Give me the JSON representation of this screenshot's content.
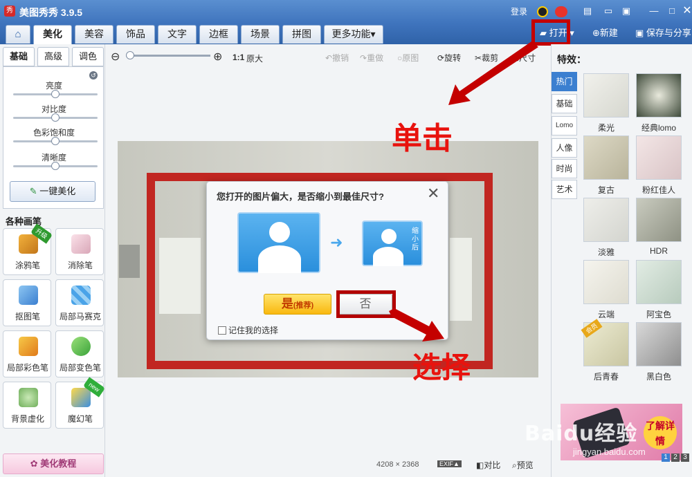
{
  "app": {
    "title": "美图秀秀 3.9.5",
    "logo_text": "秀"
  },
  "titlebar": {
    "login": "登录"
  },
  "tabs": [
    "美化",
    "美容",
    "饰品",
    "文字",
    "边框",
    "场景",
    "拼图",
    "更多功能▾"
  ],
  "actions": {
    "open": "打开",
    "new": "新建",
    "save": "保存与分享"
  },
  "panel_tabs": [
    "基础",
    "高级",
    "调色"
  ],
  "sliders": [
    "亮度",
    "对比度",
    "色彩饱和度",
    "清晰度"
  ],
  "one_key": "一键美化",
  "brushes_title": "各种画笔",
  "brushes": [
    {
      "label": "涂鸦笔",
      "badge": "升级"
    },
    {
      "label": "消除笔",
      "badge": ""
    },
    {
      "label": "抠图笔",
      "badge": ""
    },
    {
      "label": "局部马赛克",
      "badge": ""
    },
    {
      "label": "局部彩色笔",
      "badge": ""
    },
    {
      "label": "局部变色笔",
      "badge": ""
    },
    {
      "label": "背景虚化",
      "badge": ""
    },
    {
      "label": "魔幻笔",
      "badge": "new"
    }
  ],
  "tutorial": "美化教程",
  "toolbar": {
    "ratio": "1:1",
    "original_size": "原大",
    "undo": "撤销",
    "redo": "重做",
    "original": "原图",
    "rotate": "旋转",
    "crop": "裁剪",
    "resize": "尺寸"
  },
  "dialog": {
    "message": "您打开的图片偏大，是否缩小到最佳尺寸?",
    "shrink_label": "缩小后",
    "yes": "是",
    "yes_hint": "(推荐)",
    "no": "否",
    "remember": "记住我的选择"
  },
  "annotations": {
    "click": "单击",
    "choose": "选择"
  },
  "effects": {
    "title": "特效：",
    "categories": [
      "热门",
      "基础",
      "Lomo",
      "人像",
      "时尚",
      "艺术"
    ],
    "items": [
      {
        "label": "柔光",
        "badge": ""
      },
      {
        "label": "经典lomo",
        "badge": ""
      },
      {
        "label": "复古",
        "badge": ""
      },
      {
        "label": "粉红佳人",
        "badge": ""
      },
      {
        "label": "淡雅",
        "badge": ""
      },
      {
        "label": "HDR",
        "badge": ""
      },
      {
        "label": "云端",
        "badge": ""
      },
      {
        "label": "阿宝色",
        "badge": ""
      },
      {
        "label": "后青春",
        "badge": "会员"
      },
      {
        "label": "黑白色",
        "badge": ""
      }
    ]
  },
  "ad": {
    "text": "了解详情"
  },
  "pager": [
    "1",
    "2",
    "3"
  ],
  "status": {
    "width": "4208",
    "height": "2368",
    "exif": "EXIF▲",
    "compare": "对比",
    "preview": "预览"
  },
  "watermark": {
    "brand": "Baidu经验",
    "url": "jingyan.baidu.com"
  },
  "colors": {
    "titlebar": "#3f74bd",
    "annotation_red": "#e8130e",
    "highlight_box": "#c40000",
    "category_active": "#3b7fd0"
  }
}
